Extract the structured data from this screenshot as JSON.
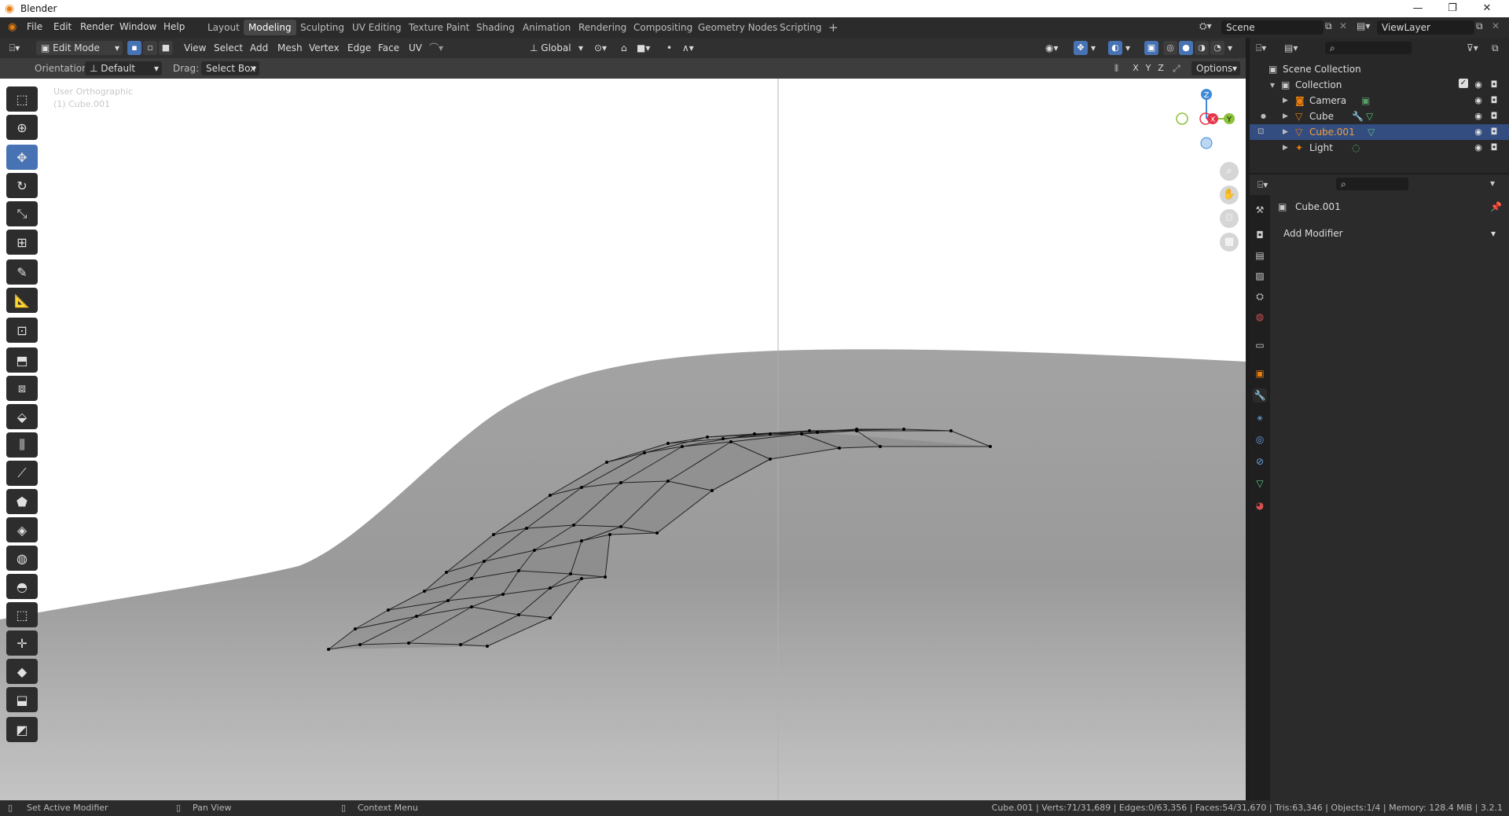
{
  "window": {
    "title": "Blender"
  },
  "menu": [
    "File",
    "Edit",
    "Render",
    "Window",
    "Help"
  ],
  "workspaces": [
    "Layout",
    "Modeling",
    "Sculpting",
    "UV Editing",
    "Texture Paint",
    "Shading",
    "Animation",
    "Rendering",
    "Compositing",
    "Geometry Nodes",
    "Scripting"
  ],
  "active_workspace": "Modeling",
  "scene": {
    "name": "Scene",
    "view_layer": "ViewLayer"
  },
  "header": {
    "mode": "Edit Mode",
    "menus": [
      "View",
      "Select",
      "Add",
      "Mesh",
      "Vertex",
      "Edge",
      "Face",
      "UV"
    ],
    "transform_orientation": "Global"
  },
  "tool_settings": {
    "orientation_label": "Orientation:",
    "orientation_value": "Default",
    "drag_label": "Drag:",
    "drag_value": "Select Box",
    "axes": [
      "X",
      "Y",
      "Z"
    ],
    "options_label": "Options"
  },
  "viewport": {
    "view_name": "User Orthographic",
    "object_name": "(1) Cube.001",
    "gizmo_axes": {
      "z": "Z",
      "y": "Y",
      "x": "X"
    }
  },
  "outliner": {
    "root": "Scene Collection",
    "collection": "Collection",
    "items": [
      {
        "name": "Camera",
        "icon": "camera-icon",
        "color": "#e87d0d"
      },
      {
        "name": "Cube",
        "icon": "mesh-icon",
        "color": "#e87d0d"
      },
      {
        "name": "Cube.001",
        "icon": "mesh-icon",
        "color": "#e87d0d",
        "selected": true
      },
      {
        "name": "Light",
        "icon": "light-icon",
        "color": "#e87d0d"
      }
    ]
  },
  "properties": {
    "object_name": "Cube.001",
    "add_modifier_label": "Add Modifier"
  },
  "status": {
    "hint1": "Set Active Modifier",
    "hint2": "Pan View",
    "hint3": "Context Menu",
    "stats": "Cube.001 | Verts:71/31,689 | Edges:0/63,356 | Faces:54/31,670 | Tris:63,346 | Objects:1/4 | Memory: 128.4 MiB | 3.2.1"
  },
  "colors": {
    "accent": "#4772b3",
    "orange": "#e87d0d",
    "x_axis": "#e5334a",
    "y_axis": "#8bc23a",
    "z_axis": "#3f8ad8"
  }
}
